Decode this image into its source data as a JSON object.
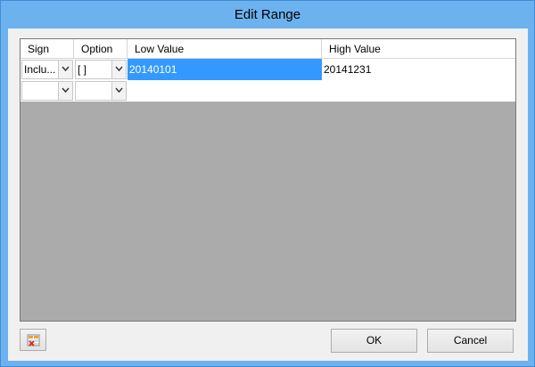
{
  "window": {
    "title": "Edit Range"
  },
  "grid": {
    "columns": [
      "Sign",
      "Option",
      "Low Value",
      "High Value"
    ],
    "rows": [
      {
        "sign": "Inclu...",
        "option": "[ ]",
        "low": "20140101",
        "high": "20141231",
        "selected": "low"
      },
      {
        "sign": "",
        "option": "",
        "low": "",
        "high": ""
      }
    ]
  },
  "buttons": {
    "ok": "OK",
    "cancel": "Cancel"
  },
  "icons": {
    "toolbar_button_icon": "multiple-selection-icon",
    "dropdown_icon": "chevron-down-icon"
  },
  "colors": {
    "title_bar": "#6cb2ee",
    "selection": "#3399ff",
    "grid_empty": "#ababab"
  }
}
